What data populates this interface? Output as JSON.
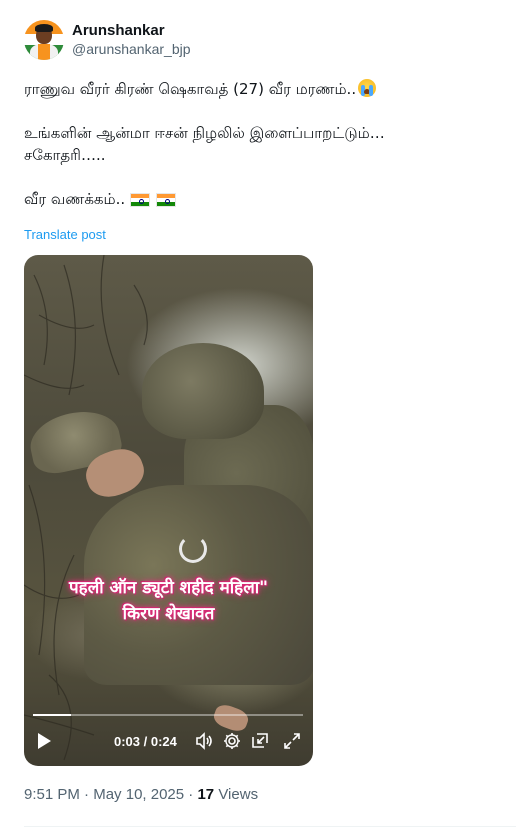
{
  "author": {
    "display_name": "Arunshankar",
    "handle": "@arunshankar_bjp"
  },
  "tweet": {
    "lines": [
      "ராணுவ வீரர் கிரண் ஷெகாவத் (27)  வீர மரணம்..",
      "உங்களின் ஆன்மா ஈசன் நிழலில் இளைப்பாறட்டும்…",
      "சகோதரி…..",
      "வீர  வணக்கம்.."
    ],
    "emoji_line1": "loudly-crying-face-emoji",
    "emoji_line4": [
      "india-flag-emoji",
      "india-flag-emoji"
    ]
  },
  "translate_label": "Translate post",
  "video": {
    "caption_line1": "पहली ऑन ड्यूटी शहीद महिला\"",
    "caption_line2": "किरण शेखावत",
    "current_time": "0:03",
    "separator": " / ",
    "duration": "0:24",
    "progress_fraction": 0.14,
    "caption_color": "#e0327d"
  },
  "meta": {
    "time": "9:51 PM",
    "dot": " · ",
    "date": "May 10, 2025",
    "views_count": "17",
    "views_label": "Views"
  },
  "colors": {
    "link": "#1d9bf0",
    "secondary_text": "#536471",
    "primary_text": "#0f1419"
  }
}
